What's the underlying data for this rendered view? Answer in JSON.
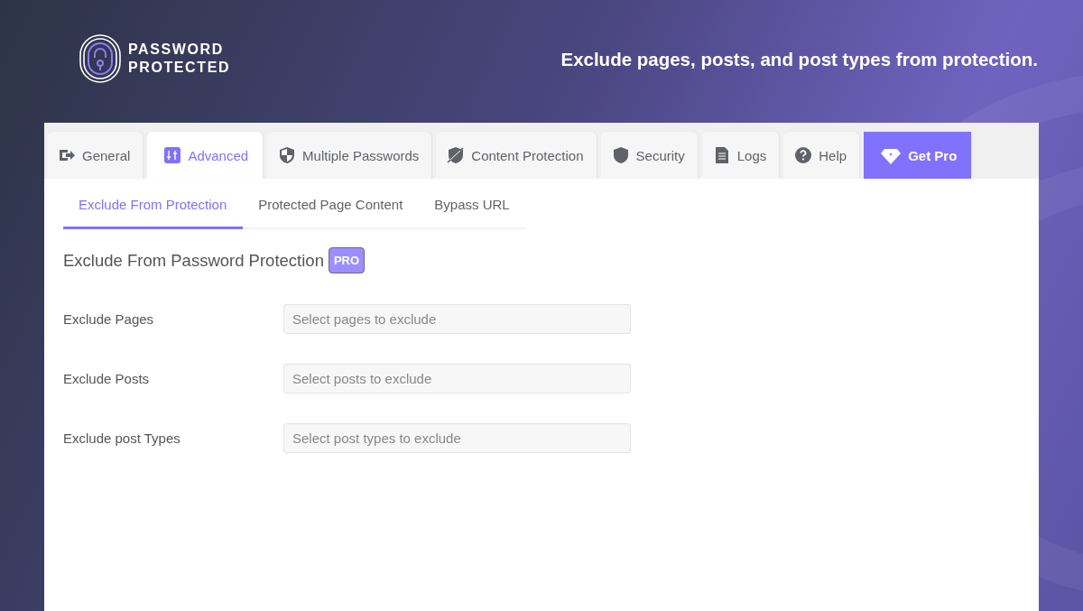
{
  "brand": {
    "line1": "PASSWORD",
    "line2": "PROTECTED"
  },
  "tagline": "Exclude pages, posts, and post types from protection.",
  "tabs": [
    {
      "label": "General",
      "kind": "tab",
      "selected": false
    },
    {
      "label": "Advanced",
      "kind": "tab",
      "selected": true
    },
    {
      "label": "Multiple Passwords",
      "kind": "tab",
      "selected": false
    },
    {
      "label": "Content Protection",
      "kind": "tab",
      "selected": false
    },
    {
      "label": "Security",
      "kind": "tab",
      "selected": false
    },
    {
      "label": "Logs",
      "kind": "tab",
      "selected": false
    },
    {
      "label": "Help",
      "kind": "tab",
      "selected": false
    },
    {
      "label": "Get Pro",
      "kind": "promo"
    }
  ],
  "subtabs": [
    {
      "label": "Exclude From Protection",
      "selected": true
    },
    {
      "label": "Protected Page Content",
      "selected": false
    },
    {
      "label": "Bypass URL",
      "selected": false
    }
  ],
  "section": {
    "title": "Exclude From Password Protection",
    "badge": "PRO"
  },
  "fields": [
    {
      "label": "Exclude Pages",
      "placeholder": "Select pages to exclude"
    },
    {
      "label": "Exclude Posts",
      "placeholder": "Select posts to exclude"
    },
    {
      "label": "Exclude post Types",
      "placeholder": "Select post types to exclude"
    }
  ]
}
